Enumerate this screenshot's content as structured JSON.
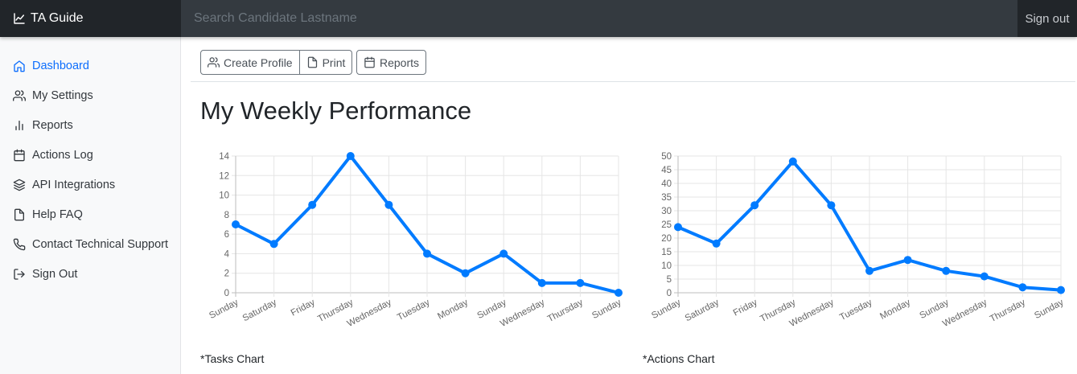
{
  "topbar": {
    "brand": "TA Guide",
    "search_placeholder": "Search Candidate Lastname",
    "signout": "Sign out"
  },
  "sidebar": {
    "items": [
      {
        "label": "Dashboard",
        "icon": "home-icon",
        "active": true
      },
      {
        "label": "My Settings",
        "icon": "users-icon",
        "active": false
      },
      {
        "label": "Reports",
        "icon": "bar-chart-icon",
        "active": false
      },
      {
        "label": "Actions Log",
        "icon": "calendar-icon",
        "active": false
      },
      {
        "label": "API Integrations",
        "icon": "layers-icon",
        "active": false
      },
      {
        "label": "Help FAQ",
        "icon": "file-icon",
        "active": false
      },
      {
        "label": "Contact Technical Support",
        "icon": "phone-icon",
        "active": false
      },
      {
        "label": "Sign Out",
        "icon": "log-out-icon",
        "active": false
      }
    ]
  },
  "toolbar": {
    "create_profile": "Create Profile",
    "print": "Print",
    "reports": "Reports"
  },
  "main": {
    "title": "My Weekly Performance",
    "caption_tasks": "*Tasks Chart",
    "caption_actions": "*Actions Chart"
  },
  "colors": {
    "accent": "#0d6efd",
    "line": "#007bff"
  },
  "chart_data": [
    {
      "type": "line",
      "categories": [
        "Sunday",
        "Saturday",
        "Friday",
        "Thursday",
        "Wednesday",
        "Tuesday",
        "Monday",
        "Sunday",
        "Wednesday",
        "Thursday",
        "Sunday"
      ],
      "values": [
        7,
        5,
        9,
        14,
        9,
        4,
        2,
        4,
        1,
        1,
        0
      ],
      "ylim": [
        0,
        14
      ],
      "yticks": [
        0,
        2,
        4,
        6,
        8,
        10,
        12,
        14
      ],
      "grid": true
    },
    {
      "type": "line",
      "categories": [
        "Sunday",
        "Saturday",
        "Friday",
        "Thursday",
        "Wednesday",
        "Tuesday",
        "Monday",
        "Sunday",
        "Wednesday",
        "Thursday",
        "Sunday"
      ],
      "values": [
        24,
        18,
        32,
        48,
        32,
        8,
        12,
        8,
        6,
        2,
        1
      ],
      "ylim": [
        0,
        50
      ],
      "yticks": [
        0,
        5,
        10,
        15,
        20,
        25,
        30,
        35,
        40,
        45,
        50
      ],
      "grid": true
    }
  ]
}
